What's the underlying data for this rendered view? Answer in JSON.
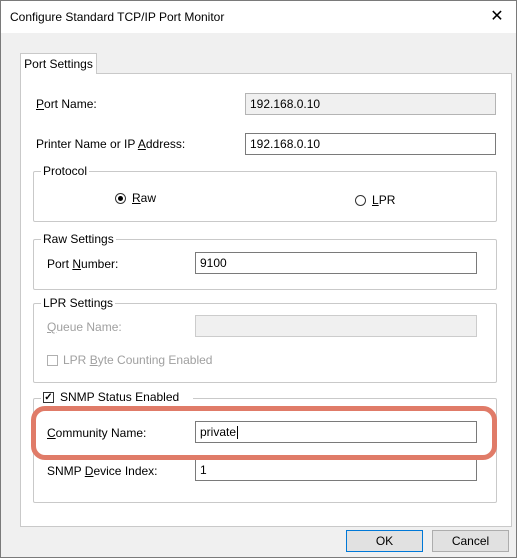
{
  "window": {
    "title": "Configure Standard TCP/IP Port Monitor",
    "close_icon": "close-icon"
  },
  "tabs": [
    {
      "label": "Port Settings",
      "active": true
    }
  ],
  "port_name": {
    "label": "Port Name:",
    "mnemonic": "P",
    "rest": "ort Name:",
    "value": "192.168.0.10"
  },
  "printer_address": {
    "label": "Printer Name or IP Address:",
    "before": "Printer Name or IP ",
    "mnemonic": "A",
    "after": "ddress:",
    "value": "192.168.0.10"
  },
  "protocol": {
    "title": "Protocol",
    "raw": {
      "label": "Raw",
      "mnemonic": "R",
      "rest": "aw",
      "selected": true
    },
    "lpr": {
      "label": "LPR",
      "mnemonic": "L",
      "rest": "PR",
      "selected": false
    }
  },
  "raw_settings": {
    "title": "Raw Settings",
    "port_number": {
      "label": "Port Number:",
      "before": "Port ",
      "mnemonic": "N",
      "after": "umber:",
      "value": "9100"
    }
  },
  "lpr_settings": {
    "title": "LPR Settings",
    "queue_name": {
      "label": "Queue Name:",
      "mnemonic": "Q",
      "rest": "ueue Name:",
      "value": ""
    },
    "byte_counting": {
      "label": "LPR Byte Counting Enabled",
      "before": "LPR ",
      "mnemonic": "B",
      "after": "yte Counting Enabled",
      "checked": false
    }
  },
  "snmp": {
    "enabled": {
      "label": "SNMP Status Enabled",
      "checked": true
    },
    "community_name": {
      "label": "Community Name:",
      "mnemonic": "C",
      "rest": "ommunity Name:",
      "value": "private"
    },
    "device_index": {
      "label": "SNMP Device Index:",
      "before": "SNMP ",
      "mnemonic": "D",
      "after": "evice Index:",
      "value": "1"
    }
  },
  "buttons": {
    "ok": "OK",
    "cancel": "Cancel"
  },
  "colors": {
    "highlight": "#e07b68",
    "default_button_border": "#0078d7"
  }
}
